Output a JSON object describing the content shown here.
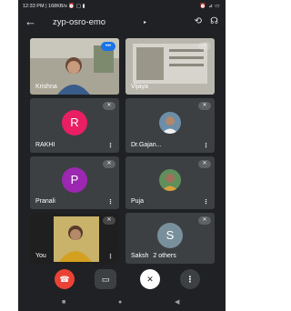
{
  "status_bar": {
    "left": "12:33 PM | 168KB/s ⏰ ▢ ▮",
    "right": "⏰ ⊿ ▭"
  },
  "header": {
    "back_icon": "arrow-back-icon",
    "title": "zyp-osro-emo",
    "caret": "▸",
    "switch_camera_icon": "camera-switch-icon",
    "audio_icon": "headset-icon"
  },
  "participants": [
    {
      "name": "Krishna",
      "type": "video",
      "speaking": true
    },
    {
      "name": "Vijaya",
      "type": "video",
      "muted": true
    },
    {
      "name": "RAKHI",
      "type": "initial",
      "initial": "R",
      "color": "#e91e63",
      "muted": true
    },
    {
      "name": "Dr.Gajan...",
      "type": "photo",
      "muted": true
    },
    {
      "name": "Pranali",
      "type": "initial",
      "initial": "P",
      "color": "#9c27b0",
      "muted": true
    },
    {
      "name": "Puja",
      "type": "photo",
      "muted": true
    },
    {
      "name": "You",
      "type": "video",
      "muted": true
    },
    {
      "name": "Saksh",
      "type": "initial",
      "initial": "S",
      "color": "#78909c",
      "muted": true,
      "others_label": "2 others"
    }
  ],
  "icons": {
    "mute": "mic-off-icon",
    "more": "⋮"
  },
  "controls": {
    "end_call": "end-call-icon",
    "camera": "video-camera-icon",
    "mic": "mic-off-icon",
    "more": "⋮"
  },
  "nav": {
    "recents": "■",
    "home": "●",
    "back": "◀"
  }
}
